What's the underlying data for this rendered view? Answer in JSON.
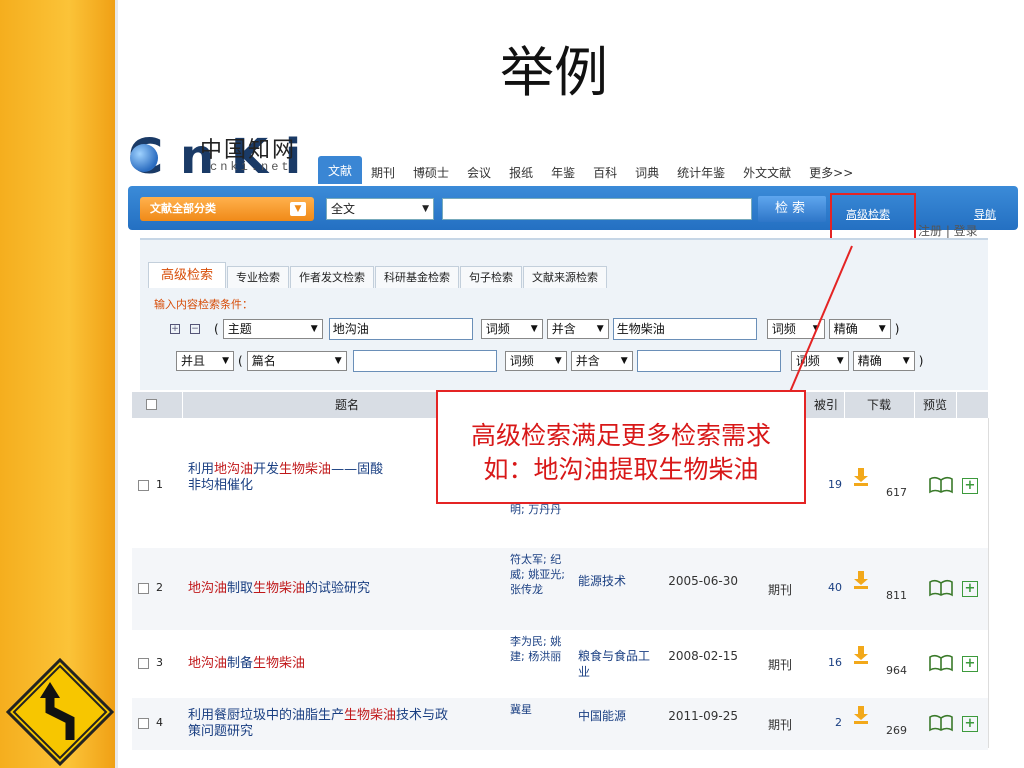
{
  "slide": {
    "title": "举例"
  },
  "site": {
    "logo_mark": "C n K i",
    "logo_cn": "中国知网",
    "logo_domain": "cnki.net"
  },
  "top_tabs": [
    {
      "label": "文献",
      "active": true
    },
    {
      "label": "期刊"
    },
    {
      "label": "博硕士"
    },
    {
      "label": "会议"
    },
    {
      "label": "报纸"
    },
    {
      "label": "年鉴"
    },
    {
      "label": "百科"
    },
    {
      "label": "词典"
    },
    {
      "label": "统计年鉴"
    },
    {
      "label": "外文文献"
    },
    {
      "label": "更多>>"
    }
  ],
  "search": {
    "category": "文献全部分类",
    "field": "全文",
    "button": "检索",
    "advanced_link": "高级检索",
    "nav_link": "导航",
    "partial_text": "注册 | 登录"
  },
  "advanced": {
    "tabs": [
      {
        "label": "高级检索",
        "active": true
      },
      {
        "label": "专业检索"
      },
      {
        "label": "作者发文检索"
      },
      {
        "label": "科研基金检索"
      },
      {
        "label": "句子检索"
      },
      {
        "label": "文献来源检索"
      }
    ],
    "hint": "输入内容检索条件：",
    "plus": "+",
    "minus": "−",
    "paren_open": "(",
    "paren_close": ")",
    "row1": {
      "field": "主题",
      "term1": "地沟油",
      "freq1": "词频",
      "combine": "并含",
      "term2": "生物柴油",
      "freq2": "词频",
      "match": "精确"
    },
    "row2": {
      "logic": "并且",
      "field": "篇名",
      "freq1": "词频",
      "combine": "并含",
      "freq2": "词频",
      "match": "精确"
    }
  },
  "results": {
    "headers": {
      "title": "题名",
      "cited": "被引",
      "downloads": "下载",
      "preview": "预览"
    },
    "rows": [
      {
        "index": "1",
        "title_parts": [
          [
            "利用",
            false
          ],
          [
            "地沟油",
            true
          ],
          [
            "开发",
            false
          ],
          [
            "生物柴油",
            true
          ],
          [
            "——固酸",
            false
          ]
        ],
        "title_line2": "非均相催化",
        "authors": "明; 万丹丹",
        "source": "",
        "date": "",
        "db": "",
        "cited": "19",
        "downloads": "617"
      },
      {
        "index": "2",
        "title_parts": [
          [
            "地沟油",
            true
          ],
          [
            "制取",
            false
          ],
          [
            "生物柴油",
            true
          ],
          [
            "的试验研究",
            false
          ]
        ],
        "title_line2": "",
        "authors": "符太军; 纪威; 姚亚光; 张传龙",
        "source": "能源技术",
        "date": "2005-06-30",
        "db": "期刊",
        "cited": "40",
        "downloads": "811"
      },
      {
        "index": "3",
        "title_parts": [
          [
            "地沟油",
            true
          ],
          [
            "制备",
            false
          ],
          [
            "生物柴油",
            true
          ]
        ],
        "title_line2": "",
        "authors": "李为民; 姚建; 杨洪丽",
        "source": "粮食与食品工业",
        "date": "2008-02-15",
        "db": "期刊",
        "cited": "16",
        "downloads": "964"
      },
      {
        "index": "4",
        "title_parts": [
          [
            "利用餐厨垃圾中的油脂生产",
            false
          ],
          [
            "生物柴油",
            true
          ],
          [
            "技术与政",
            false
          ]
        ],
        "title_line2": "策问题研究",
        "authors": "冀星",
        "source": "中国能源",
        "date": "2011-09-25",
        "db": "期刊",
        "cited": "2",
        "downloads": "269"
      }
    ]
  },
  "annotation": {
    "line1": "高级检索满足更多检索需求",
    "line2": "如：地沟油提取生物柴油"
  },
  "colors": {
    "accent_blue": "#2470c2",
    "highlight_red": "#e42424",
    "keyword_red": "#c0181a",
    "sidebar_gold": "#fbc338"
  }
}
